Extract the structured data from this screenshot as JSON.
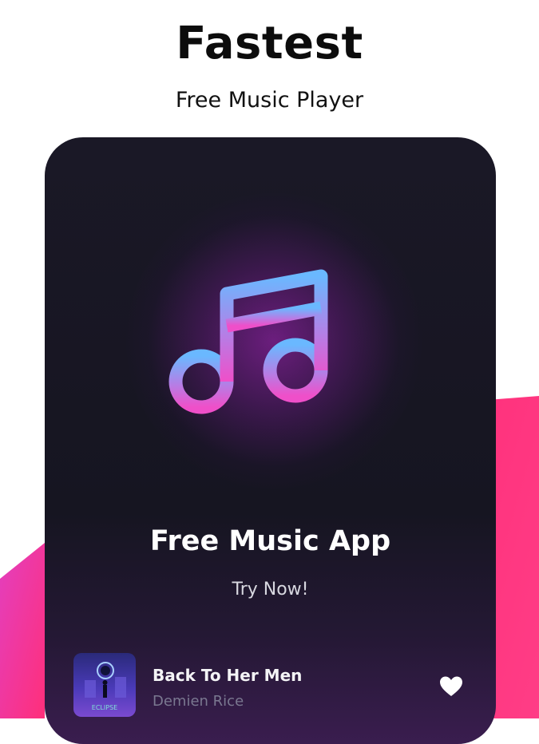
{
  "header": {
    "title": "Fastest",
    "subtitle": "Free Music Player"
  },
  "card": {
    "icon": "music-note-icon",
    "title": "Free Music App",
    "cta_label": "Try Now!"
  },
  "now_playing": {
    "track_title": "Back To Her Men",
    "artist": "Demien Rice",
    "album_art_text": "ECLIPSE",
    "favorite_icon": "heart-icon"
  },
  "colors": {
    "accent_pink": "#ff2f7a",
    "accent_magenta": "#e33fbf",
    "card_background": "#1a1826",
    "icon_gradient_top": "#6ab8ff",
    "icon_gradient_bottom": "#ef4fc9"
  }
}
